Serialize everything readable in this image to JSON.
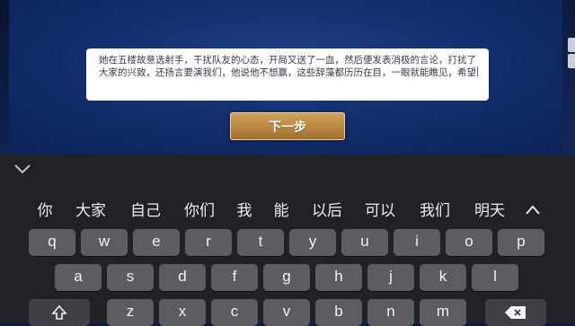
{
  "game": {
    "report_text": "她在五楼故意选射手，干扰队友的心态，开局又送了一血，然后便发表消极的言论，打扰了大家的兴致，还扬言要演我们，他说他不想赢，这些辞藻都历历在目，一眼就能瞧见，希望",
    "next_button_label": "下一步"
  },
  "keyboard": {
    "suggestions": [
      "你",
      "大家",
      "自己",
      "你们",
      "我",
      "能",
      "以后",
      "可以",
      "我们",
      "明天"
    ],
    "row1": [
      "q",
      "w",
      "e",
      "r",
      "t",
      "y",
      "u",
      "i",
      "o",
      "p"
    ],
    "row2": [
      "a",
      "s",
      "d",
      "f",
      "g",
      "h",
      "j",
      "k",
      "l"
    ],
    "row3": [
      "z",
      "x",
      "c",
      "v",
      "b",
      "n",
      "m"
    ],
    "icons": {
      "collapse": "chevron-down-icon",
      "expand_suggestions": "chevron-up-icon",
      "shift": "shift-icon",
      "delete": "backspace-icon"
    }
  },
  "colors": {
    "game_background": "#14306f",
    "button_gold": "#b98742",
    "keyboard_background": "#202226",
    "key_fill": "#5c5d62",
    "caret": "#3a6df0"
  }
}
